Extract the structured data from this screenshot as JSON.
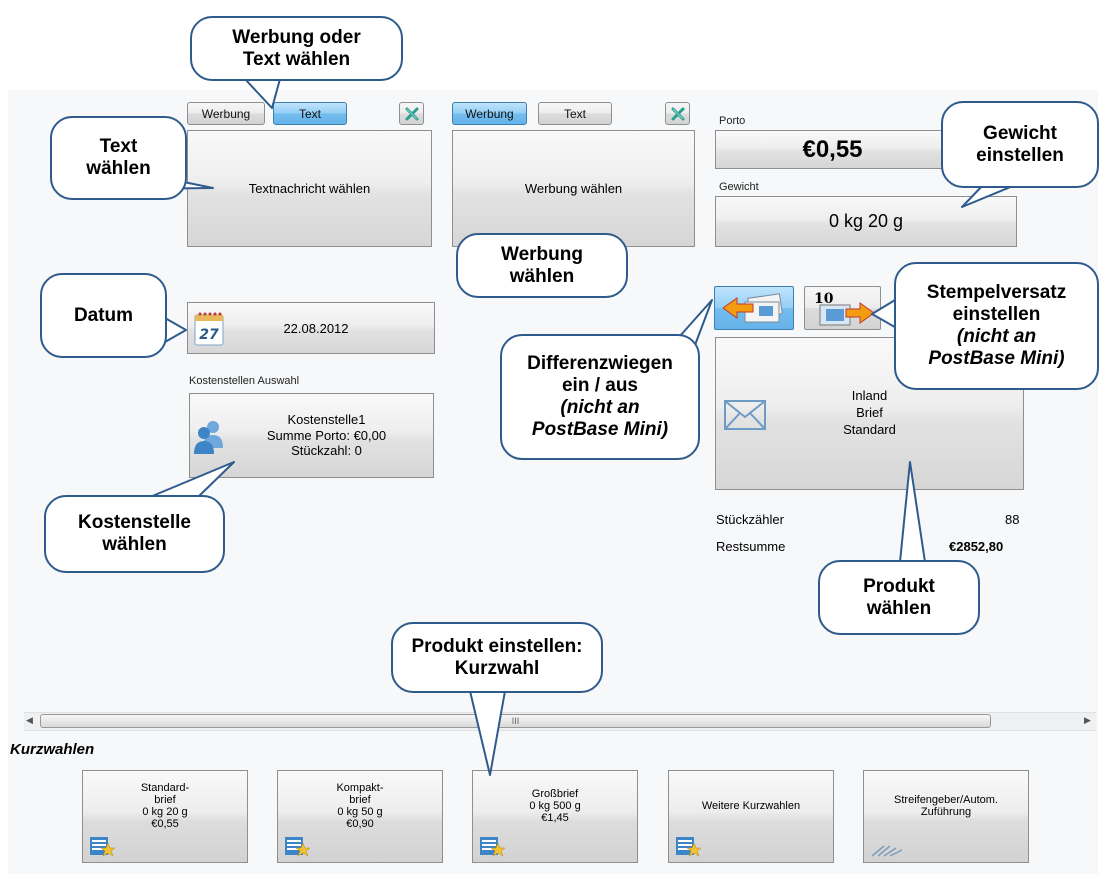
{
  "text_section": {
    "werbung_tab": "Werbung",
    "text_tab": "Text",
    "main_button": "Textnachricht wählen"
  },
  "ad_section": {
    "werbung_tab": "Werbung",
    "text_tab": "Text",
    "main_button": "Werbung wählen"
  },
  "porto": {
    "label": "Porto",
    "value": "€0,55"
  },
  "gewicht": {
    "label": "Gewicht",
    "value": "0 kg 20 g"
  },
  "date": {
    "value": "22.08.2012",
    "icon_number": "27"
  },
  "cost_center": {
    "section_label": "Kostenstellen Auswahl",
    "name": "Kostenstelle1",
    "summe_porto": "Summe Porto: €0,00",
    "stueckzahl": "Stückzahl: 0"
  },
  "stamp_icon_number": "10",
  "product": {
    "line1": "Inland",
    "line2": "Brief",
    "line3": "Standard"
  },
  "counters": {
    "stueckzaehler_label": "Stückzähler",
    "stueckzaehler_value": "88",
    "restsumme_label": "Restsumme",
    "restsumme_value": "€2852,80"
  },
  "scrollbar": {
    "thumb_grip": "III"
  },
  "kurzwahlen": {
    "title": "Kurzwahlen",
    "items": [
      {
        "lines": [
          "Standard-",
          "brief",
          "0 kg 20 g",
          "€0,55"
        ],
        "icon": "quick-select-star-icon"
      },
      {
        "lines": [
          "Kompakt-",
          "brief",
          "0 kg 50 g",
          "€0,90"
        ],
        "icon": "quick-select-star-icon"
      },
      {
        "lines": [
          "Großbrief",
          "0 kg 500 g",
          "€1,45"
        ],
        "icon": "quick-select-star-icon"
      },
      {
        "lines": [
          "Weitere Kurzwahlen"
        ],
        "icon": "quick-select-star-icon"
      },
      {
        "lines": [
          "Streifengeber/Autom.",
          "Zuführung"
        ],
        "icon": "strip-feeder-icon"
      }
    ]
  },
  "callouts": {
    "werbung_oder_text": [
      "Werbung oder",
      "Text wählen"
    ],
    "text_waehlen": [
      "Text",
      "wählen"
    ],
    "werbung_waehlen": [
      "Werbung",
      "wählen"
    ],
    "gewicht_einstellen": [
      "Gewicht",
      "einstellen"
    ],
    "datum": [
      "Datum"
    ],
    "stempelversatz": [
      "Stempelversatz",
      "einstellen",
      "(nicht an",
      "PostBase Mini)"
    ],
    "differenzwiegen": [
      "Differenzwiegen",
      "ein / aus",
      "(nicht an",
      "PostBase Mini)"
    ],
    "kostenstelle": [
      "Kostenstelle",
      "wählen"
    ],
    "produkt_waehlen": [
      "Produkt",
      "wählen"
    ],
    "produkt_einstellen": [
      "Produkt einstellen:",
      "Kurzwahl"
    ]
  }
}
